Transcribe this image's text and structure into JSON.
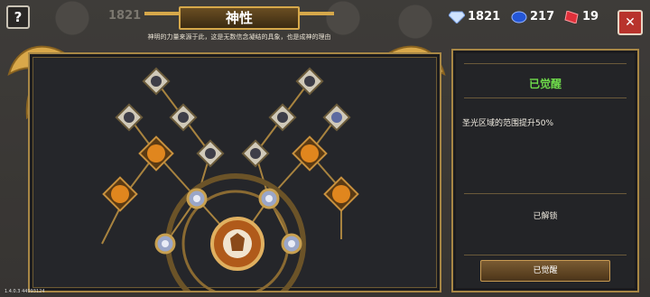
{
  "header": {
    "help_label": "?",
    "title": "神性",
    "subtitle": "神明的力量来源于此，这是无数信念凝结的具象，也是成神的理由",
    "ghost_count": "1821"
  },
  "currency": [
    {
      "name": "diamond",
      "icon": "diamond-icon",
      "value": "1821",
      "color": "#b9d6ff"
    },
    {
      "name": "sapphire",
      "icon": "sapphire-icon",
      "value": "217",
      "color": "#2456d6"
    },
    {
      "name": "ruby",
      "icon": "ruby-icon",
      "value": "19",
      "color": "#e0303a"
    }
  ],
  "close_label": "✕",
  "side_panel": {
    "status_title": "已觉醒",
    "description": "圣光区域的范围提升50%",
    "unlock_label": "已解锁",
    "button_label": "已觉醒"
  },
  "version": "1.4.0.3 44993124",
  "colors": {
    "gold": "#d6a84a",
    "awakened_green": "#6fdc4b",
    "panel_bg": "#25262a"
  }
}
